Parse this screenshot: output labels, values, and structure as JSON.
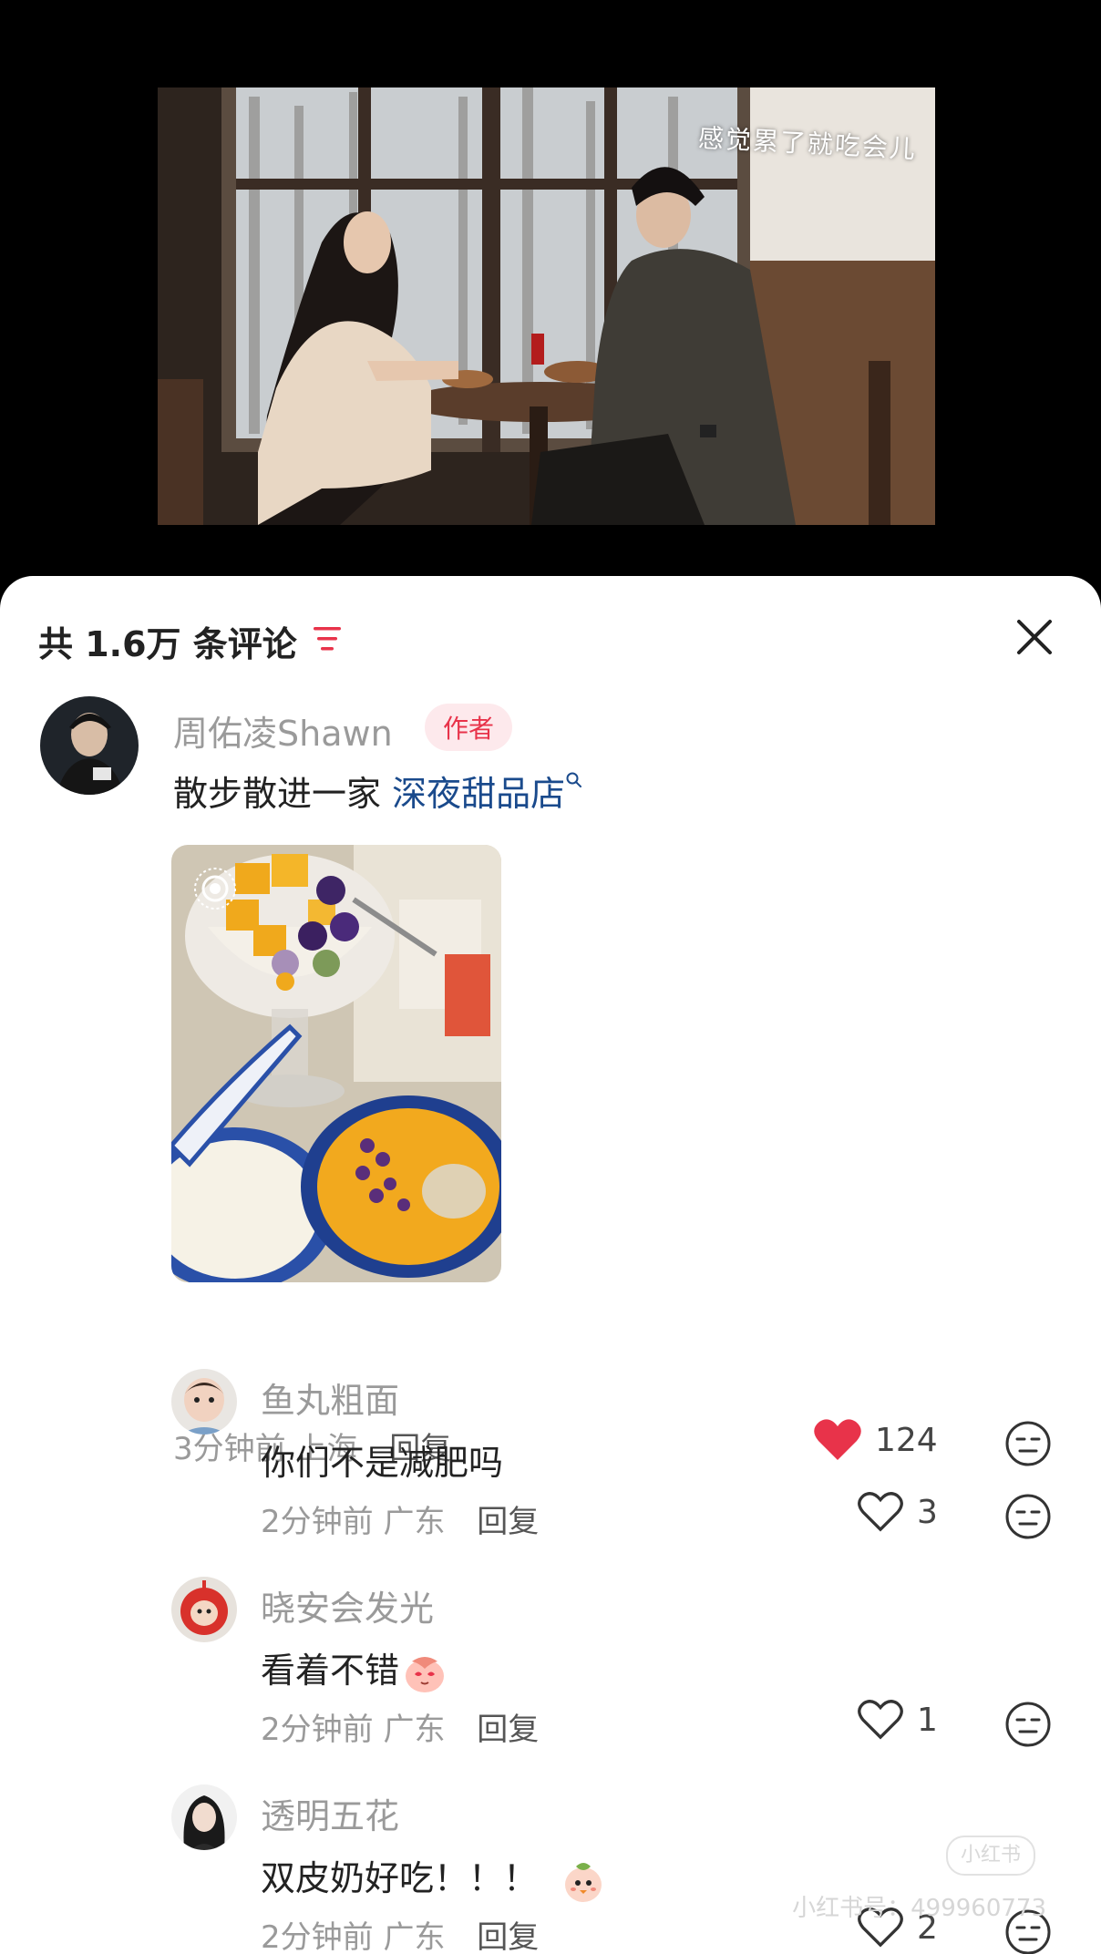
{
  "video": {
    "caption": "感觉累了就吃会儿"
  },
  "header": {
    "count_title": "共 1.6万 条评论"
  },
  "comments": [
    {
      "author": "周佑凌Shawn",
      "badge": "作者",
      "text": "散步散进一家 ",
      "link_text": "深夜甜品店",
      "time": "3分钟前",
      "location": "上海",
      "reply": "回复",
      "likes": "124",
      "liked": true
    },
    {
      "author": "鱼丸粗面",
      "text": "你们不是减肥吗",
      "time": "2分钟前",
      "location": "广东",
      "reply": "回复",
      "likes": "3",
      "liked": false
    },
    {
      "author": "晓安会发光",
      "text": "看着不错",
      "time": "2分钟前",
      "location": "广东",
      "reply": "回复",
      "likes": "1",
      "liked": false
    },
    {
      "author": "透明五花",
      "text": "双皮奶好吃！！！",
      "time": "2分钟前",
      "location": "广东",
      "reply": "回复",
      "likes": "2",
      "liked": false
    }
  ],
  "watermark": {
    "text": "小红书号：499960773"
  },
  "colors": {
    "accent": "#e8334a",
    "link": "#1a4a8c",
    "muted": "#9a9a9a"
  },
  "icons": [
    "filter-icon",
    "close-icon",
    "heart-icon",
    "heart-outline-icon",
    "reaction-icon",
    "live-photo-icon",
    "search-icon"
  ]
}
